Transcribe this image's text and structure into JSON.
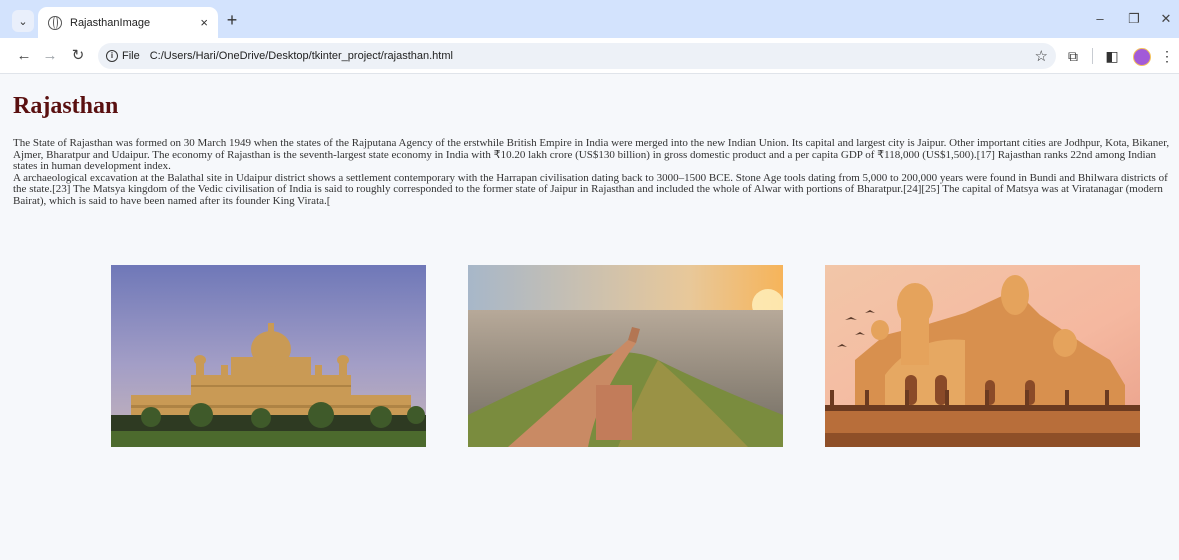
{
  "browser": {
    "tab_title": "RajasthanImage",
    "tab_close": "×",
    "new_tab": "+",
    "url_scheme": "File",
    "url": "C:/Users/Hari/OneDrive/Desktop/tkinter_project/rajasthan.html",
    "window_controls": {
      "minimize": "–",
      "restore": "❐",
      "close": "✕"
    }
  },
  "page": {
    "heading": "Rajasthan",
    "paragraph_1": "The State of Rajasthan was formed on 30 March 1949 when the states of the Rajputana Agency of the erstwhile British Empire in India were merged into the new Indian Union. Its capital and largest city is Jaipur. Other important cities are Jodhpur, Kota, Bikaner, Ajmer, Bharatpur and Udaipur. The economy of Rajasthan is the seventh-largest state economy in India with ₹10.20 lakh crore (US$130 billion) in gross domestic product and a per capita GDP of ₹118,000 (US$1,500).[17] Rajasthan ranks 22nd among Indian states in human development index.",
    "paragraph_2": "A archaeological excavation at the Balathal site in Udaipur district shows a settlement contemporary with the Harrapan civilisation dating back to 3000–1500 BCE. Stone Age tools dating from 5,000 to 200,000 years were found in Bundi and Bhilwara districts of the state.[23] The Matsya kingdom of the Vedic civilisation of India is said to roughly corresponded to the former state of Jaipur in Rajasthan and included the whole of Alwar with portions of Bharatpur.[24][25] The capital of Matsya was at Viratanagar (modern Bairat), which is said to have been named after its founder King Virata.["
  },
  "colors": {
    "tabstrip": "#d3e3fd",
    "heading": "#5a1010",
    "page_bg": "#f6f8fb"
  }
}
